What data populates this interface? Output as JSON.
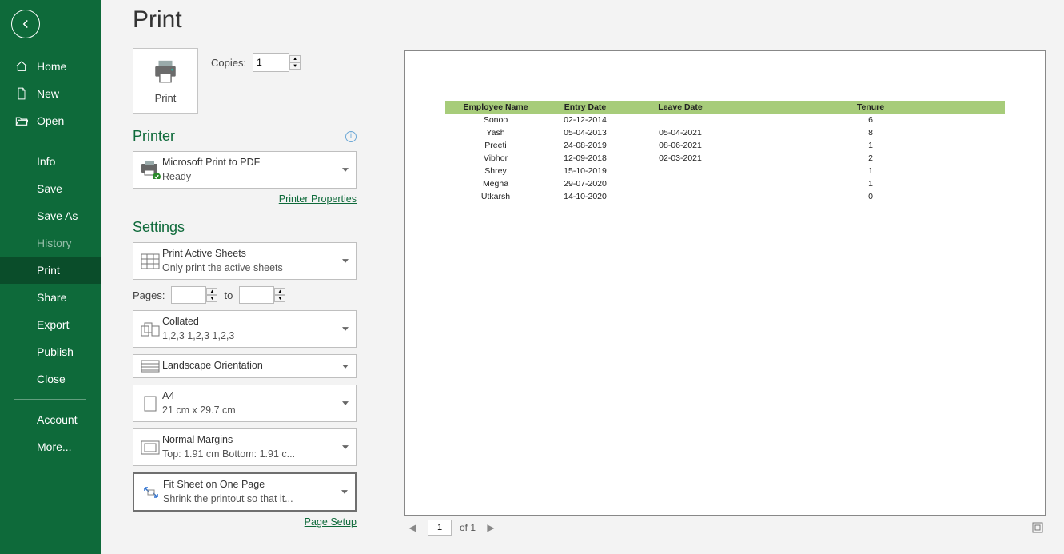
{
  "page": {
    "title": "Print"
  },
  "sidebar": {
    "home": "Home",
    "new": "New",
    "open": "Open",
    "info": "Info",
    "save": "Save",
    "saveas": "Save As",
    "history": "History",
    "print": "Print",
    "share": "Share",
    "export": "Export",
    "publish": "Publish",
    "close": "Close",
    "account": "Account",
    "more": "More..."
  },
  "print": {
    "button_label": "Print",
    "copies_label": "Copies:",
    "copies_value": "1"
  },
  "printer": {
    "heading": "Printer",
    "name": "Microsoft Print to PDF",
    "status": "Ready",
    "properties_link": "Printer Properties"
  },
  "settings": {
    "heading": "Settings",
    "active_sheets": {
      "title": "Print Active Sheets",
      "sub": "Only print the active sheets"
    },
    "pages_label_from": "Pages:",
    "pages_from": "",
    "pages_label_to": "to",
    "pages_to": "",
    "collated": {
      "title": "Collated",
      "sub": "1,2,3    1,2,3    1,2,3"
    },
    "orientation": {
      "title": "Landscape Orientation"
    },
    "paper": {
      "title": "A4",
      "sub": "21 cm x 29.7 cm"
    },
    "margins": {
      "title": "Normal Margins",
      "sub": "Top: 1.91 cm Bottom: 1.91 c..."
    },
    "scaling": {
      "title": "Fit Sheet on One Page",
      "sub": "Shrink the printout so that it..."
    },
    "page_setup_link": "Page Setup"
  },
  "chart_data": {
    "type": "table",
    "columns": [
      "Employee Name",
      "Entry Date",
      "Leave Date",
      "Tenure"
    ],
    "rows": [
      [
        "Sonoo",
        "02-12-2014",
        "",
        "6"
      ],
      [
        "Yash",
        "05-04-2013",
        "05-04-2021",
        "8"
      ],
      [
        "Preeti",
        "24-08-2019",
        "08-06-2021",
        "1"
      ],
      [
        "Vibhor",
        "12-09-2018",
        "02-03-2021",
        "2"
      ],
      [
        "Shrey",
        "15-10-2019",
        "",
        "1"
      ],
      [
        "Megha",
        "29-07-2020",
        "",
        "1"
      ],
      [
        "Utkarsh",
        "14-10-2020",
        "",
        "0"
      ]
    ]
  },
  "nav": {
    "page": "1",
    "of_label": "of 1"
  }
}
